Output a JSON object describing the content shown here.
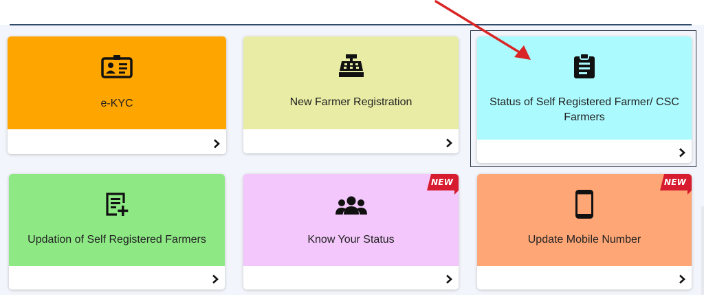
{
  "cards": [
    {
      "title": "e-KYC",
      "icon": "id-card-icon",
      "color": "#ffa500"
    },
    {
      "title": "New Farmer Registration",
      "icon": "cash-register-icon",
      "color": "#e8eca4"
    },
    {
      "title": "Status of Self Registered Farmer/ CSC Farmers",
      "icon": "clipboard-icon",
      "color": "#abfafd"
    },
    {
      "title": "Updation of Self Registered Farmers",
      "icon": "edit-list-icon",
      "color": "#8ee985"
    },
    {
      "title": "Know Your Status",
      "icon": "users-icon",
      "color": "#f3c7fb",
      "badge": "NEW"
    },
    {
      "title": "Update Mobile Number",
      "icon": "mobile-phone-icon",
      "color": "#fea676",
      "badge": "NEW"
    }
  ],
  "colors": {
    "badge": "#d61c2e",
    "annotation_arrow": "#d92525",
    "rule": "#2f4a6b"
  }
}
